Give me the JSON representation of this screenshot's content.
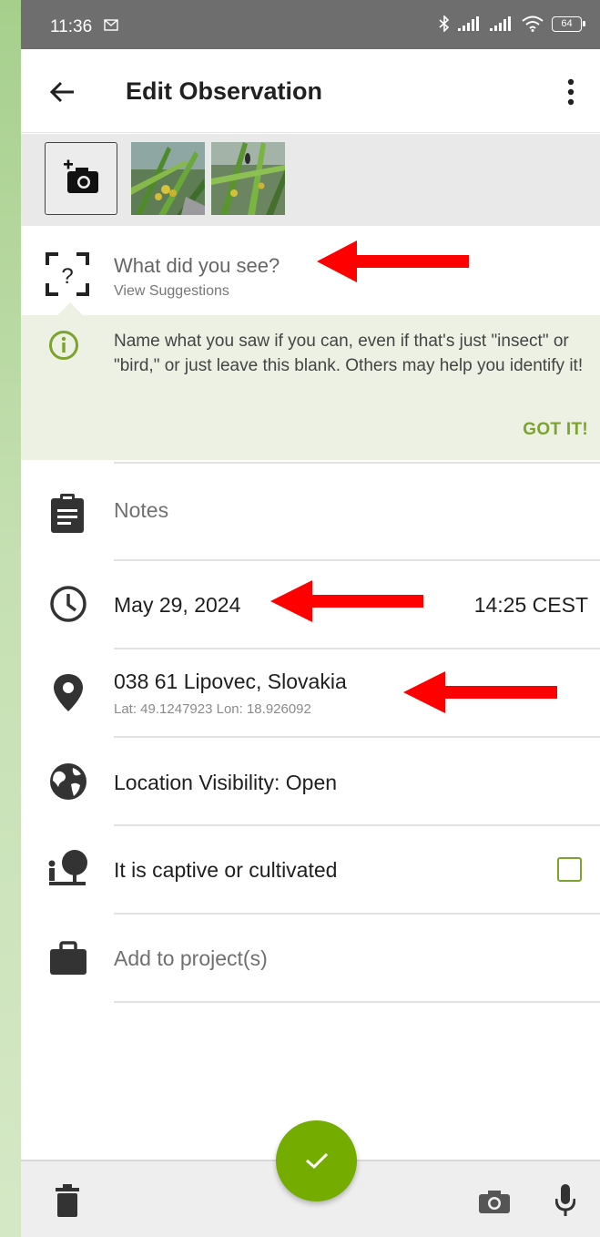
{
  "status_bar": {
    "time": "11:36",
    "battery": "64",
    "icons": [
      "message-icon",
      "bluetooth-icon",
      "signal-icon",
      "signal-icon",
      "wifi-icon",
      "battery-icon"
    ]
  },
  "app_bar": {
    "title": "Edit Observation",
    "back_icon": "arrow-left-icon",
    "menu_icon": "more-vert-icon"
  },
  "photos": {
    "add_icon": "add-photo-icon",
    "count": 2
  },
  "species": {
    "prompt": "What did you see?",
    "suggestions_link": "View Suggestions",
    "icon": "species-unknown-icon"
  },
  "tip": {
    "text": "Name what you saw if you can, even if that's just \"insect\" or \"bird,\" or just leave this blank. Others may help you identify it!",
    "dismiss": "GOT IT!",
    "icon": "info-icon"
  },
  "fields": {
    "notes_placeholder": "Notes",
    "date": "May 29, 2024",
    "time": "14:25 CEST",
    "location": "038 61 Lipovec, Slovakia",
    "coords": "Lat: 49.1247923 Lon: 18.926092",
    "visibility": "Location Visibility: Open",
    "captive_label": "It is captive or cultivated",
    "captive_checked": false,
    "projects_placeholder": "Add to project(s)"
  },
  "bottom_bar": {
    "icons": [
      "trash-icon",
      "camera-icon",
      "microphone-icon"
    ],
    "fab_icon": "check-icon"
  },
  "colors": {
    "accent_green": "#74ac00",
    "link_green": "#7ca32d",
    "tip_background": "#edf1e3",
    "status_bar": "#6e6e6e",
    "annotation_arrow": "#ff0000"
  }
}
